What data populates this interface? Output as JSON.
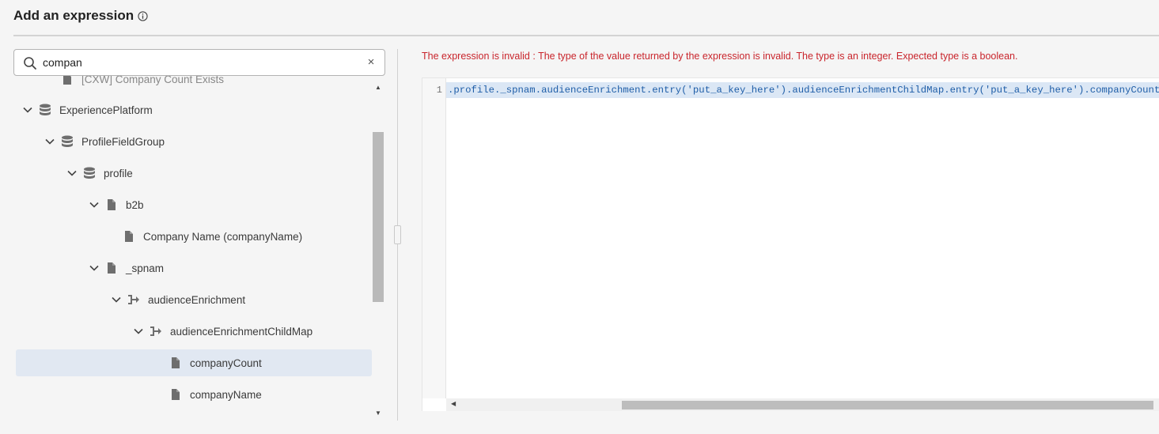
{
  "header": {
    "title": "Add an expression"
  },
  "search": {
    "value": "compan"
  },
  "tree": {
    "partial_item": "[CXW] Company Count Exists",
    "items": [
      {
        "label": "ExperiencePlatform",
        "icon": "database-icon"
      },
      {
        "label": "ProfileFieldGroup",
        "icon": "database-icon"
      },
      {
        "label": "profile",
        "icon": "database-icon"
      },
      {
        "label": "b2b",
        "icon": "file-icon"
      },
      {
        "label": "Company Name (companyName)",
        "icon": "file-icon"
      },
      {
        "label": "_spnam",
        "icon": "file-icon"
      },
      {
        "label": "audienceEnrichment",
        "icon": "map-icon"
      },
      {
        "label": "audienceEnrichmentChildMap",
        "icon": "map-icon"
      },
      {
        "label": "companyCount",
        "icon": "file-icon"
      },
      {
        "label": "companyName",
        "icon": "file-icon"
      }
    ]
  },
  "error": {
    "message": "The expression is invalid : The type of the value returned by the expression is invalid. The type is an integer. Expected type is a boolean.",
    "color": "#c9252c"
  },
  "editor": {
    "line_number": "1",
    "code": ".profile._spnam.audienceEnrichment.entry('put_a_key_here').audienceEnrichmentChildMap.entry('put_a_key_here').companyCount",
    "closing_brace": "}"
  },
  "colors": {
    "selected_row": "#e1e8f2",
    "code_text": "#1f5ea8"
  }
}
